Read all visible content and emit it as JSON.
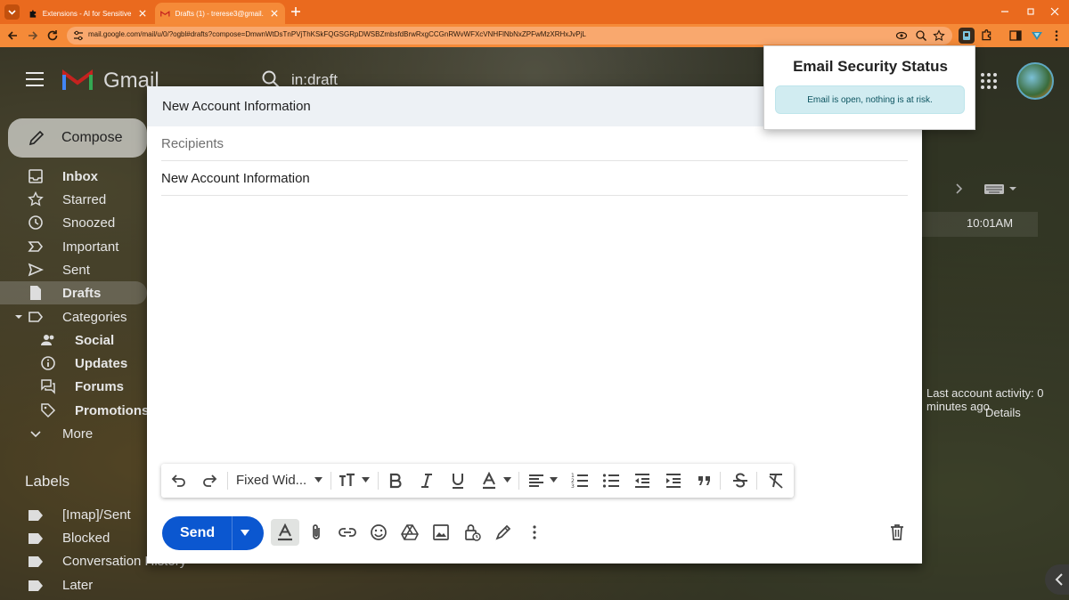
{
  "browser": {
    "tabs": [
      {
        "label": "Extensions - AI for Sensitive Sc",
        "active": false,
        "icon": "puzzle-icon"
      },
      {
        "label": "Drafts (1) - trerese3@gmail.com",
        "active": true,
        "icon": "gmail-icon"
      }
    ],
    "url": "mail.google.com/mail/u/0/?ogbl#drafts?compose=DmwnWtDsTnPVjThKSkFQGSGRpDWSBZmbsfdBrwRxgCCGnRWvWFXcVNHFlNbNxZPFwMzXRHxJvPjL",
    "accent_color": "#ea6a1e"
  },
  "gmail": {
    "logo_text": "Gmail",
    "search_value": "in:draft",
    "compose_label": "Compose",
    "nav": [
      {
        "label": "Inbox",
        "icon": "inbox-icon",
        "bold": true
      },
      {
        "label": "Starred",
        "icon": "star-icon",
        "bold": false
      },
      {
        "label": "Snoozed",
        "icon": "clock-icon",
        "bold": false
      },
      {
        "label": "Important",
        "icon": "important-icon",
        "bold": false
      },
      {
        "label": "Sent",
        "icon": "send-icon",
        "bold": false
      },
      {
        "label": "Drafts",
        "icon": "draft-icon",
        "bold": true,
        "active": true
      },
      {
        "label": "Categories",
        "icon": "label-icon",
        "bold": false
      }
    ],
    "categories": [
      {
        "label": "Social",
        "icon": "people-icon"
      },
      {
        "label": "Updates",
        "icon": "info-icon"
      },
      {
        "label": "Forums",
        "icon": "forum-icon"
      },
      {
        "label": "Promotions",
        "icon": "tag-icon"
      }
    ],
    "more_label": "More",
    "labels_heading": "Labels",
    "labels": [
      {
        "label": "[Imap]/Sent"
      },
      {
        "label": "Blocked"
      },
      {
        "label": "Conversation History"
      },
      {
        "label": "Later"
      }
    ],
    "message_time": "10:01AM",
    "activity_text": "Last account activity: 0 minutes ago",
    "details_link": "Details"
  },
  "compose": {
    "title": "New Account Information",
    "recipients_placeholder": "Recipients",
    "subject": "New Account Information",
    "format_toolbar": {
      "font_name": "Fixed Wid..."
    },
    "send_label": "Send"
  },
  "extension_popup": {
    "title": "Email Security Status",
    "status_message": "Email is open, nothing is at risk.",
    "status_color": "#d1ecf1"
  }
}
